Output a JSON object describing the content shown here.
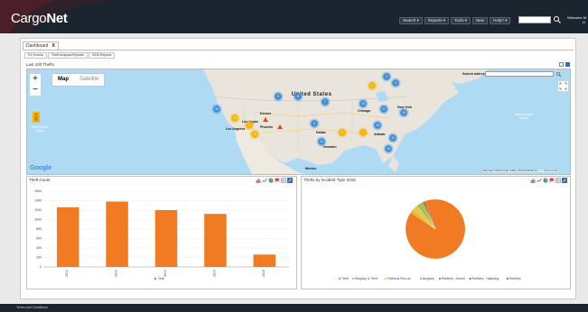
{
  "header": {
    "logo_cargo": "Cargo",
    "logo_net": "Net",
    "nav": [
      "Search ▾",
      "Reports ▾",
      "Tools ▾",
      "New",
      "Help? ▾"
    ],
    "welcome": "Welcome M",
    "welcome_user": "LI"
  },
  "tabs": {
    "main_label": "Dashboard",
    "close_symbol": "X",
    "sub": [
      "RV Events",
      "Theft Analysis Reports",
      "2016 Reports"
    ]
  },
  "map_panel": {
    "title": "Last 100 Thefts",
    "btn_map": "Map",
    "btn_satellite": "Satellite",
    "search_label": "Search address:",
    "country_label": "United States",
    "mexico": "Mexico",
    "north_pacific": "North Pacific Ocean",
    "north_atlantic": "North Atlantic Ocean",
    "cities": [
      "Denver",
      "Las Vegas",
      "Los Angeles",
      "Phoenix",
      "Dallas",
      "Houston",
      "Chicago",
      "Atlanta",
      "New York"
    ],
    "google": "Google",
    "footer": "Map data ©2016 Google, INEGI, ORION-ME   500 km ⎯⎯⎯⎯   Terms of Use",
    "cluster_labels": [
      "2",
      "3",
      "4",
      "5",
      "6",
      "7",
      "10",
      "11",
      "12",
      "13",
      "15"
    ]
  },
  "theft_count": {
    "title": "Theft Count",
    "legend": "Year"
  },
  "incident_type": {
    "title": "Thefts by Incident Type 2016",
    "legend": [
      "Theft",
      "Burglary & Theft",
      "Fictitious Pick-up",
      "Burglary",
      "Robbery - Armed",
      "Robbery - Hijacking",
      "Robbery"
    ]
  },
  "footer": {
    "link": "Terms and Conditions"
  },
  "chart_data": [
    {
      "type": "bar",
      "title": "Theft Count",
      "categories": [
        "2012",
        "2013",
        "2014",
        "2015",
        "2016"
      ],
      "series": [
        {
          "name": "Year",
          "values": [
            1260,
            1380,
            1200,
            1120,
            260
          ]
        }
      ],
      "yticks": [
        0,
        200,
        400,
        600,
        800,
        1000,
        1200,
        1400,
        1600
      ],
      "ylim": [
        0,
        1600
      ],
      "color": "#f07b22"
    },
    {
      "type": "pie",
      "title": "Thefts by Incident Type 2016",
      "labels": [
        "Theft",
        "Burglary & Theft",
        "Fictitious Pick-up",
        "Burglary",
        "Robbery - Armed",
        "Robbery - Hijacking",
        "Robbery"
      ],
      "values": [
        90,
        2,
        3,
        3,
        0.5,
        0.5,
        1
      ],
      "colors": [
        "#f07b22",
        "#e3b52b",
        "#f0c24a",
        "#9ec24d",
        "#6b9a2e",
        "#4a7b2b",
        "#d94a1c"
      ]
    }
  ]
}
